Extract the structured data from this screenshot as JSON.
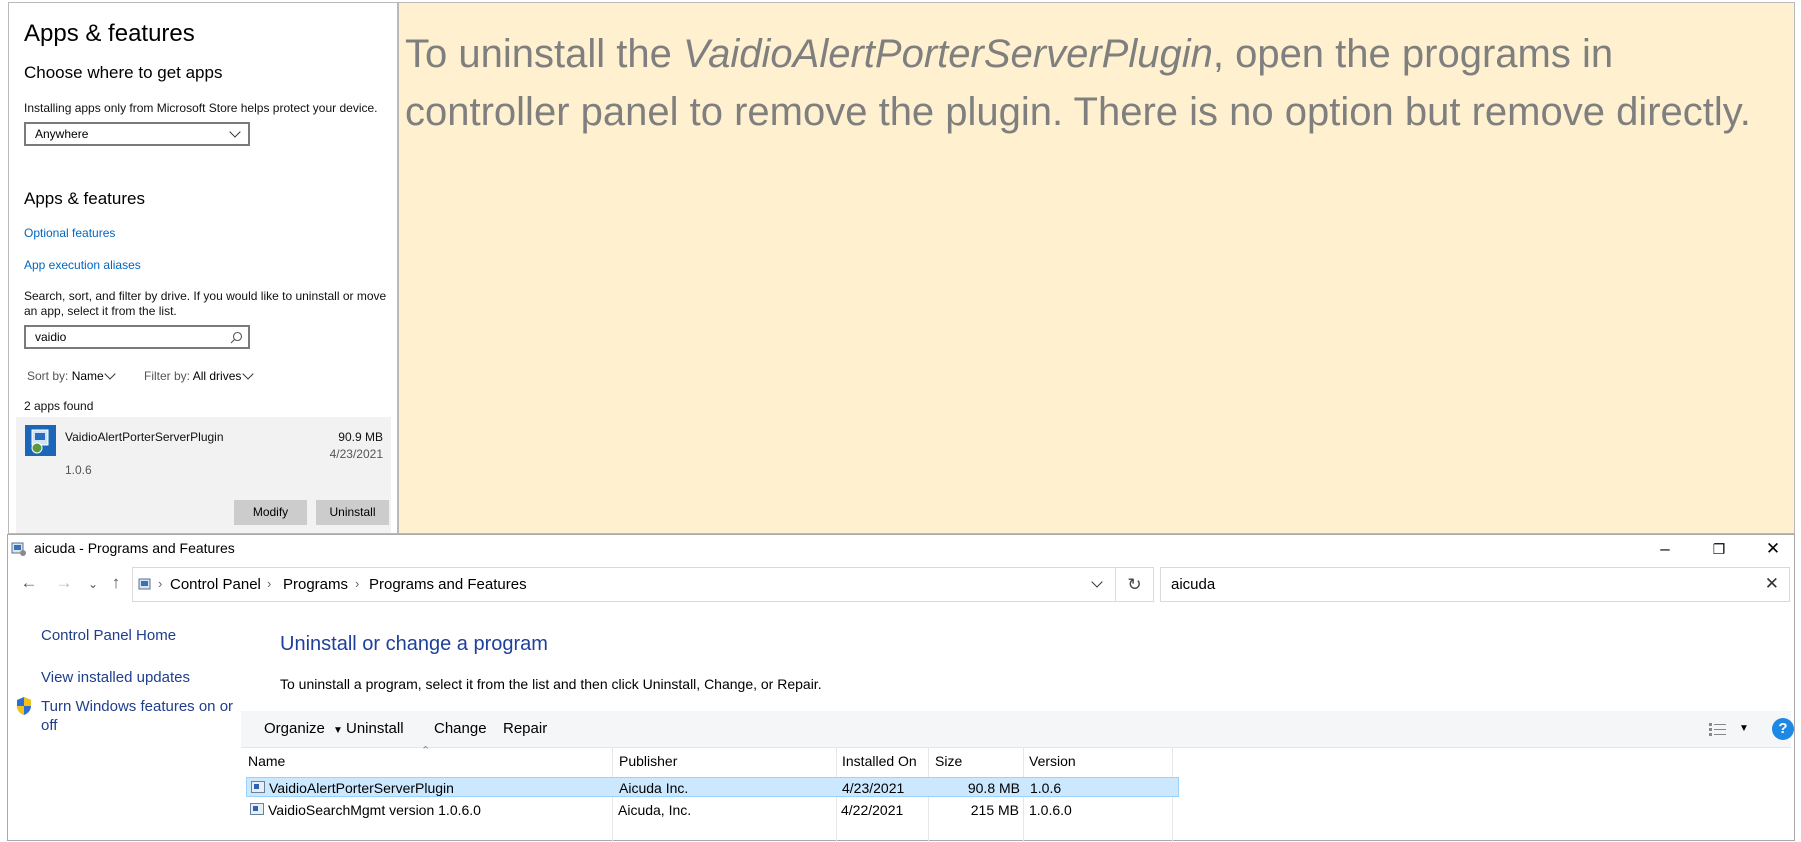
{
  "settings": {
    "title": "Apps & features",
    "choose_heading": "Choose where to get apps",
    "install_info": "Installing apps only from Microsoft Store helps protect your device.",
    "source_dropdown_value": "Anywhere",
    "apps_heading": "Apps & features",
    "optional_features_link": "Optional features",
    "app_execution_link": "App execution aliases",
    "search_help": "Search, sort, and filter by drive. If you would like to uninstall or move an app, select it from the list.",
    "search_value": "vaidio",
    "sort_label": "Sort by:",
    "sort_value": "Name",
    "filter_label": "Filter by:",
    "filter_value": "All drives",
    "found_count": "2 apps found",
    "app": {
      "name": "VaidioAlertPorterServerPlugin",
      "size": "90.9 MB",
      "date": "4/23/2021",
      "version": "1.0.6",
      "modify_label": "Modify",
      "uninstall_label": "Uninstall"
    }
  },
  "note": {
    "pre": "To uninstall the ",
    "emph": "VaidioAlertPorterServerPlugin",
    "post": ", open the programs in controller panel to remove the plugin. There is no option but remove directly."
  },
  "window": {
    "title": "aicuda - Programs and Features",
    "breadcrumb": [
      "Control Panel",
      "Programs",
      "Programs and Features"
    ],
    "search_value": "aicuda",
    "sidebar": {
      "home": "Control Panel Home",
      "updates": "View installed updates",
      "features_line1": "Turn Windows features on or",
      "features_line2": "off"
    },
    "heading": "Uninstall or change a program",
    "instructions": "To uninstall a program, select it from the list and then click Uninstall, Change, or Repair.",
    "toolbar": {
      "organize": "Organize",
      "uninstall": "Uninstall",
      "change": "Change",
      "repair": "Repair",
      "help": "?"
    },
    "columns": [
      "Name",
      "Publisher",
      "Installed On",
      "Size",
      "Version"
    ],
    "rows": [
      {
        "name": "VaidioAlertPorterServerPlugin",
        "publisher": "Aicuda Inc.",
        "installed": "4/23/2021",
        "size": "90.8 MB",
        "version": "1.0.6"
      },
      {
        "name": "VaidioSearchMgmt version 1.0.6.0",
        "publisher": "Aicuda, Inc.",
        "installed": "4/22/2021",
        "size": "215 MB",
        "version": "1.0.6.0"
      }
    ]
  },
  "colors": {
    "note_bg": "#fff1cf",
    "link_blue": "#0067c0",
    "selection": "#cce8ff"
  }
}
